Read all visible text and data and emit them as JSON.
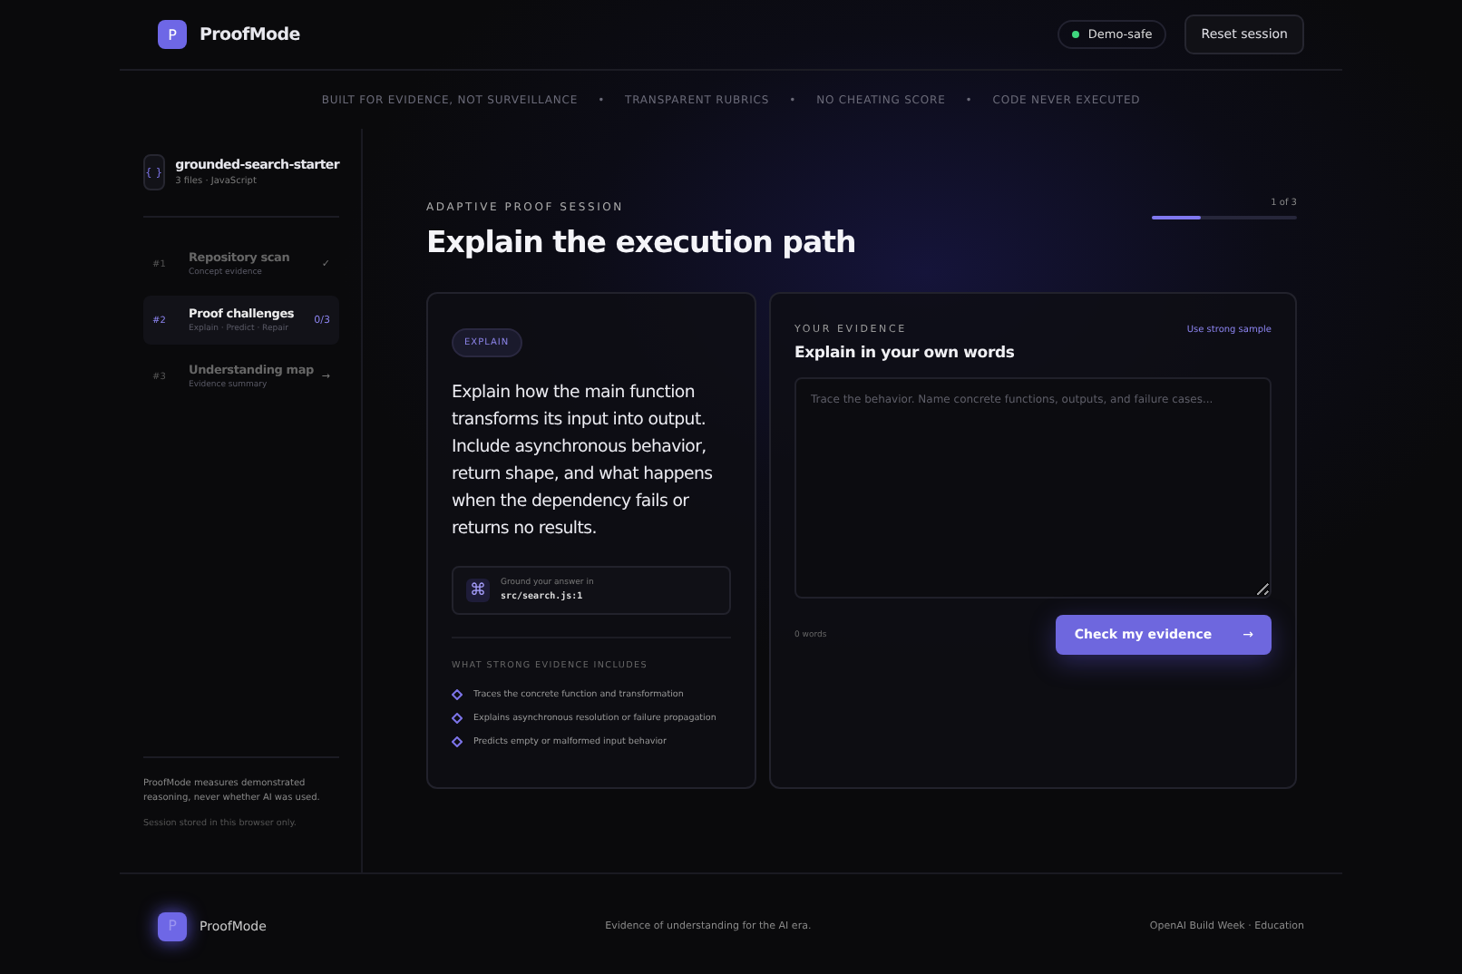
{
  "header": {
    "logo_letter": "P",
    "brand": "ProofMode",
    "status_badge": {
      "label": "Demo-safe",
      "on": true
    },
    "reset_button": "Reset session"
  },
  "banner": [
    "BUILT FOR EVIDENCE, NOT SURVEILLANCE",
    "TRANSPARENT RUBRICS",
    "NO CHEATING SCORE",
    "CODE NEVER EXECUTED"
  ],
  "banner_separator": "•",
  "sidebar": {
    "repo": {
      "icon": "{ }",
      "name": "grounded-search-starter",
      "meta": "3 files · JavaScript"
    },
    "steps": [
      {
        "number": "#1",
        "title": "Repository scan",
        "subtitle": "Concept evidence",
        "status": "✓",
        "selected": false
      },
      {
        "number": "#2",
        "title": "Proof challenges",
        "subtitle": "Explain · Predict · Repair",
        "status": "0/3",
        "selected": true
      },
      {
        "number": "#3",
        "title": "Understanding map",
        "subtitle": "Evidence summary",
        "status": "→",
        "selected": false
      }
    ],
    "note": "ProofMode measures demonstrated reasoning, never whether AI was used.",
    "storage": "Session stored in this browser only."
  },
  "session": {
    "eyebrow": "ADAPTIVE PROOF SESSION",
    "title": "Explain the execution path",
    "progress": {
      "label": "1 of 3",
      "level": 0.34
    }
  },
  "prompt_card": {
    "tag": "EXPLAIN",
    "prompt": "Explain how the main function transforms its input into output. Include asynchronous behavior, return shape, and what happens when the dependency fails or returns no results.",
    "ground": {
      "icon": "⌘",
      "label": "Ground your answer in",
      "path": "src/search.js:1"
    },
    "criteria_heading": "WHAT STRONG EVIDENCE INCLUDES",
    "criteria": [
      "Traces the concrete function and transformation",
      "Explains asynchronous resolution or failure propagation",
      "Predicts empty or malformed input behavior"
    ]
  },
  "evidence_card": {
    "eyebrow": "YOUR EVIDENCE",
    "title": "Explain in your own words",
    "sample_link": "Use strong sample",
    "placeholder": "Trace the behavior. Name concrete functions, outputs, and failure cases...",
    "word_count": "0 words",
    "submit_button": "Check my evidence",
    "submit_arrow": "→"
  },
  "footer": {
    "logo_letter": "P",
    "brand": "ProofMode",
    "tagline": "Evidence of understanding for the AI era.",
    "credit": "OpenAI Build Week · Education"
  }
}
